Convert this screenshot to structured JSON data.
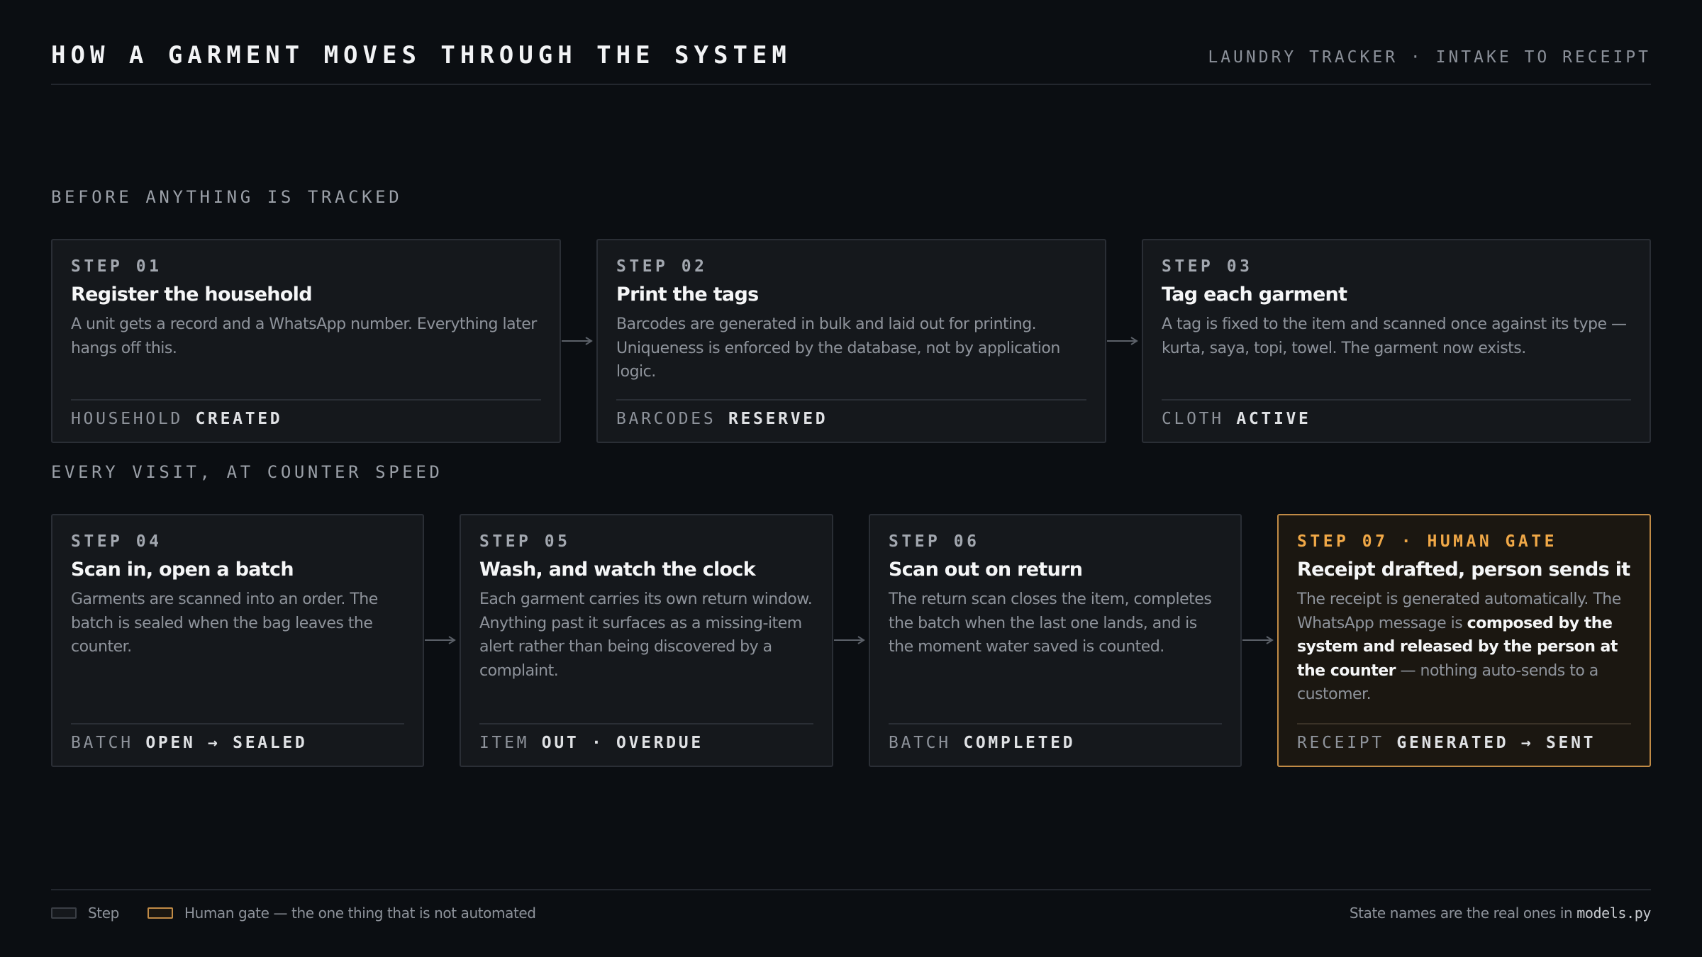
{
  "header": {
    "title": "HOW A GARMENT MOVES THROUGH THE SYSTEM",
    "subtitle": "LAUNDRY TRACKER · INTAKE TO RECEIPT"
  },
  "sections": [
    {
      "label": "BEFORE ANYTHING IS TRACKED"
    },
    {
      "label": "EVERY VISIT, AT COUNTER SPEED"
    }
  ],
  "steps": [
    {
      "number": "STEP 01",
      "title": "Register the household",
      "body": "A unit gets a record and a WhatsApp number. Everything later hangs off this.",
      "state_entity": "HOUSEHOLD",
      "state_value": "CREATED"
    },
    {
      "number": "STEP 02",
      "title": "Print the tags",
      "body": "Barcodes are generated in bulk and laid out for printing. Uniqueness is enforced by the database, not by application logic.",
      "state_entity": "BARCODES",
      "state_value": "RESERVED"
    },
    {
      "number": "STEP 03",
      "title": "Tag each garment",
      "body": "A tag is fixed to the item and scanned once against its type — kurta, saya, topi, towel. The garment now exists.",
      "state_entity": "CLOTH",
      "state_value": "ACTIVE"
    },
    {
      "number": "STEP 04",
      "title": "Scan in, open a batch",
      "body": "Garments are scanned into an order. The batch is sealed when the bag leaves the counter.",
      "state_entity": "BATCH",
      "state_value": "OPEN → SEALED"
    },
    {
      "number": "STEP 05",
      "title": "Wash, and watch the clock",
      "body": "Each garment carries its own return window. Anything past it surfaces as a missing-item alert rather than being discovered by a complaint.",
      "state_entity": "ITEM",
      "state_value": "OUT · OVERDUE"
    },
    {
      "number": "STEP 06",
      "title": "Scan out on return",
      "body": "The return scan closes the item, completes the batch when the last one lands, and is the moment water saved is counted.",
      "state_entity": "BATCH",
      "state_value": "COMPLETED"
    },
    {
      "number": "STEP 07 · HUMAN GATE",
      "title": "Receipt drafted, person sends it",
      "body_before": "The receipt is generated automatically. The WhatsApp message is ",
      "body_emphasis": "composed by the system and released by the person at the counter",
      "body_after": " — nothing auto-sends to a customer.",
      "state_entity": "RECEIPT",
      "state_value": "GENERATED → SENT"
    }
  ],
  "legend": {
    "step_label": "Step",
    "gate_label": "Human gate — the one thing that is not automated"
  },
  "footer": {
    "note": "State names are the real ones in",
    "code": "models.py"
  },
  "colors": {
    "background": "#0b0e12",
    "card": "#15181c",
    "card_border": "#2a2e35",
    "gate_border": "#c18b46",
    "gate_accent": "#f0a847"
  }
}
